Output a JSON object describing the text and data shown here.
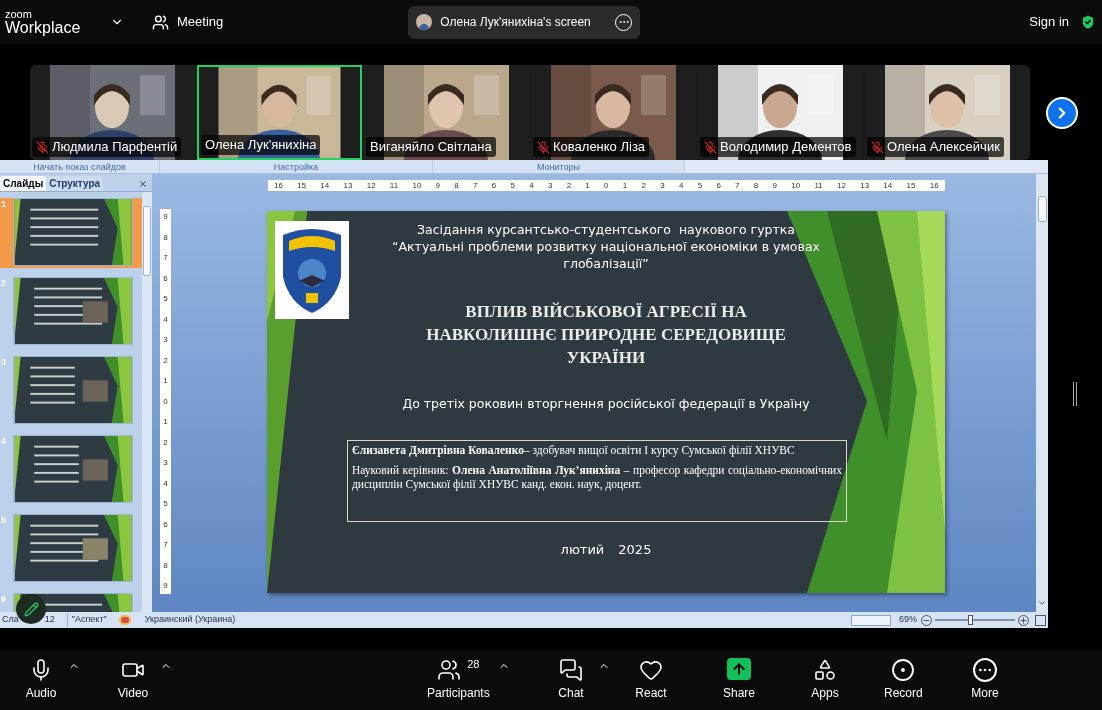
{
  "top_bar": {
    "brand_small": "zoom",
    "brand": "Workplace",
    "meeting_label": "Meeting",
    "share_label": "Олена Лук'янихіна's screen",
    "sign_in": "Sign in"
  },
  "participants": [
    {
      "name": "Людмила Парфентій",
      "muted": true,
      "speaking": false
    },
    {
      "name": "Олена Лук'янихіна",
      "muted": false,
      "speaking": true
    },
    {
      "name": "Виганяйло Світлана",
      "muted": false,
      "speaking": false
    },
    {
      "name": "Коваленко Ліза",
      "muted": true,
      "speaking": false
    },
    {
      "name": "Володимир Дементов",
      "muted": true,
      "speaking": false
    },
    {
      "name": "Олена Алексейчик",
      "muted": true,
      "speaking": false
    }
  ],
  "ribbon_groups": [
    "Начать показ слайдов",
    "Настройка",
    "Мониторы"
  ],
  "slides_panel": {
    "tabs": [
      {
        "label": "Слайды",
        "selected": true
      },
      {
        "label": "Структура",
        "selected": false
      }
    ],
    "slides": [
      {
        "number": "1",
        "selected": true
      },
      {
        "number": "2",
        "selected": false
      },
      {
        "number": "3",
        "selected": false
      },
      {
        "number": "4",
        "selected": false
      },
      {
        "number": "5",
        "selected": false
      },
      {
        "number": "6",
        "selected": false
      }
    ]
  },
  "ruler_h": [
    "16",
    "15",
    "14",
    "13",
    "12",
    "11",
    "10",
    "9",
    "8",
    "7",
    "6",
    "5",
    "4",
    "3",
    "2",
    "1",
    "0",
    "1",
    "2",
    "3",
    "4",
    "5",
    "6",
    "7",
    "8",
    "9",
    "10",
    "11",
    "12",
    "13",
    "14",
    "15",
    "16"
  ],
  "ruler_v": [
    "9",
    "8",
    "7",
    "6",
    "5",
    "4",
    "3",
    "2",
    "1",
    "0",
    "1",
    "2",
    "3",
    "4",
    "5",
    "6",
    "7",
    "8",
    "9"
  ],
  "slide": {
    "header_lines": [
      "Засідання курсантсько-студентського  наукового гуртка",
      "“Актуальні проблеми розвитку національної економіки в умовах",
      "глобалізації”"
    ],
    "title_lines": [
      "ВПЛИВ ВІЙСЬКОВОЇ АГРЕСІЇ НА",
      "НАВКОЛИШНЄ ПРИРОДНЕ СЕРЕДОВИЩЕ",
      "УКРАЇНИ"
    ],
    "subtitle": "До третіх роковин вторгнення російської федерації в Україну",
    "authors": [
      "**Єлизавета Дмитрівна Коваленко**– здобувач вищої освіти І курсу Сумської філії ХНУВС",
      "Науковий керівник: **Олена Анатоліївна Лук’янихіна** – професор кафедри соціально-економічних дисциплін Сумської філії ХНУВС канд. екон. наук, доцент."
    ],
    "date": [
      "лютий",
      "2025"
    ]
  },
  "status_bar": {
    "slide_parts": [
      "Сла",
      "12"
    ],
    "theme": "\"Аспект\"",
    "language": "Украинский (Украина)",
    "zoom": "69%",
    "level": 0.45
  },
  "toolbar": [
    {
      "kind": "audio",
      "label": "Audio",
      "menu": true
    },
    {
      "kind": "video",
      "label": "Video",
      "menu": true
    },
    {
      "kind": "participants",
      "label": "Participants",
      "badge": "28",
      "menu": true
    },
    {
      "kind": "chat",
      "label": "Chat",
      "menu": true
    },
    {
      "kind": "react",
      "label": "React",
      "menu": false
    },
    {
      "kind": "share",
      "label": "Share",
      "menu": false
    },
    {
      "kind": "apps",
      "label": "Apps",
      "menu": false
    },
    {
      "kind": "record",
      "label": "Record",
      "menu": false
    },
    {
      "kind": "more",
      "label": "More",
      "menu": false
    }
  ]
}
